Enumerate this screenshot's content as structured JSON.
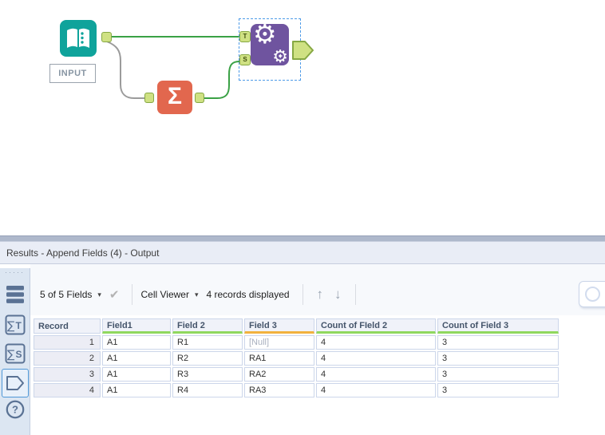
{
  "canvas": {
    "input_tool_label": "INPUT",
    "summarize_glyph": "Σ",
    "anchor_t": "T",
    "anchor_s": "S",
    "gear_glyph": "⚙",
    "gear_plus": "+",
    "colors": {
      "input_teal": "#0FA39B",
      "summarize_orange": "#E2674E",
      "append_purple": "#6F549F",
      "anchor_green_fill": "#CFE183",
      "anchor_green_border": "#86A843",
      "wire_green": "#3AA145",
      "wire_gray": "#9B9B9B",
      "selection_blue": "#4D9BE8"
    }
  },
  "results": {
    "title": "Results - Append Fields (4) - Output",
    "toolbar": {
      "fields_dropdown": "5 of 5 Fields",
      "fields_caret": "▾",
      "apply_check": "✔",
      "cell_viewer_dropdown": "Cell Viewer",
      "cell_viewer_caret": "▾",
      "records_text": "4 records displayed",
      "up_arrow": "↑",
      "down_arrow": "↓"
    },
    "sidebar": {
      "grip_dots": "·····",
      "sigma": "∑",
      "t_label": "T",
      "s_label": "S",
      "help_glyph": "?",
      "icon_names": [
        "table-view",
        "input-anchor-t",
        "input-anchor-s",
        "output-anchor",
        "help"
      ]
    },
    "table": {
      "status_colors": {
        "ok_underline": "#90D85E",
        "warn_underline": "#F2B23E"
      },
      "columns": [
        {
          "label": "Record",
          "underline": "none"
        },
        {
          "label": "Field1",
          "underline": "green"
        },
        {
          "label": "Field 2",
          "underline": "green"
        },
        {
          "label": "Field 3",
          "underline": "orange"
        },
        {
          "label": "Count of FIeld 2",
          "underline": "green"
        },
        {
          "label": "Count of Field 3",
          "underline": "green"
        }
      ],
      "rows": [
        {
          "cells": [
            "1",
            "A1",
            "R1",
            "[Null]",
            "4",
            "3"
          ]
        },
        {
          "cells": [
            "2",
            "A1",
            "R2",
            "RA1",
            "4",
            "3"
          ]
        },
        {
          "cells": [
            "3",
            "A1",
            "R3",
            "RA2",
            "4",
            "3"
          ]
        },
        {
          "cells": [
            "4",
            "A1",
            "R4",
            "RA3",
            "4",
            "3"
          ]
        }
      ]
    }
  }
}
